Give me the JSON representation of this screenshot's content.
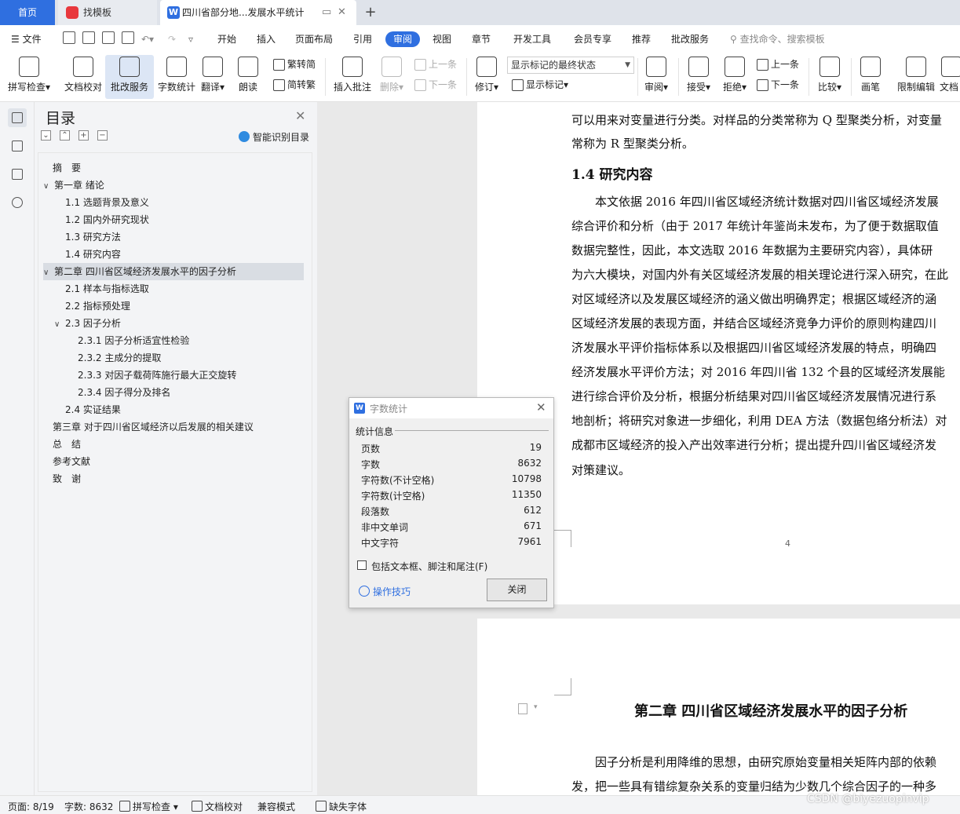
{
  "tabs": {
    "home": "首页",
    "template": "找模板",
    "document": "四川省部分地...发展水平统计"
  },
  "menu": {
    "file": "文件",
    "items": [
      "开始",
      "插入",
      "页面布局",
      "引用",
      "审阅",
      "视图",
      "章节",
      "开发工具",
      "会员专享",
      "推荐",
      "批改服务"
    ],
    "active": "审阅",
    "search": "查找命令、搜索模板"
  },
  "ribbon": {
    "spellcheck": "拼写检查",
    "doc_proof": "文档校对",
    "correction_service": "批改服务",
    "word_count": "字数统计",
    "translate": "翻译",
    "read_aloud": "朗读",
    "trad_to_simp": "繁转简",
    "simp_to_trad": "简转繁",
    "insert_comment": "插入批注",
    "delete": "删除",
    "prev_item": "上一条",
    "next_item": "下一条",
    "revise": "修订",
    "markup_state": "显示标记的最终状态",
    "show_markup": "显示标记",
    "review": "审阅",
    "accept": "接受",
    "reject": "拒绝",
    "prev_change": "上一条",
    "next_change": "下一条",
    "compare": "比较",
    "pen": "画笔",
    "restrict_edit": "限制编辑",
    "more": "文档"
  },
  "toc": {
    "title": "目录",
    "smart": "智能识别目录",
    "items": [
      {
        "text": "摘　要",
        "level": 0,
        "caret": ""
      },
      {
        "text": "第一章 绪论",
        "level": 0,
        "caret": "∨"
      },
      {
        "text": "1.1 选题背景及意义",
        "level": 1,
        "caret": ""
      },
      {
        "text": "1.2 国内外研究现状",
        "level": 1,
        "caret": ""
      },
      {
        "text": "1.3 研究方法",
        "level": 1,
        "caret": ""
      },
      {
        "text": "1.4 研究内容",
        "level": 1,
        "caret": ""
      },
      {
        "text": "第二章 四川省区域经济发展水平的因子分析",
        "level": 0,
        "caret": "∨"
      },
      {
        "text": "2.1 样本与指标选取",
        "level": 1,
        "caret": ""
      },
      {
        "text": "2.2 指标预处理",
        "level": 1,
        "caret": ""
      },
      {
        "text": "2.3 因子分析",
        "level": 1,
        "caret": "∨"
      },
      {
        "text": "2.3.1 因子分析适宜性检验",
        "level": 2,
        "caret": ""
      },
      {
        "text": "2.3.2 主成分的提取",
        "level": 2,
        "caret": ""
      },
      {
        "text": "2.3.3 对因子载荷阵施行最大正交旋转",
        "level": 2,
        "caret": ""
      },
      {
        "text": "2.3.4 因子得分及排名",
        "level": 2,
        "caret": ""
      },
      {
        "text": "2.4 实证结果",
        "level": 1,
        "caret": ""
      },
      {
        "text": "第三章 对于四川省区域经济以后发展的相关建议",
        "level": 0,
        "caret": ""
      },
      {
        "text": "总　结",
        "level": 0,
        "caret": ""
      },
      {
        "text": "参考文献",
        "level": 0,
        "caret": ""
      },
      {
        "text": "致　谢",
        "level": 0,
        "caret": ""
      }
    ]
  },
  "document": {
    "page1_lines": [
      "可以用来对变量进行分类。对样品的分类常称为 Q 型聚类分析，对变量",
      "常称为 R 型聚类分析。",
      "1.4  研究内容",
      "　　本文依据 2016 年四川省区域经济统计数据对四川省区域经济发展",
      "综合评价和分析（由于 2017 年统计年鉴尚未发布，为了便于数据取值",
      "数据完整性，因此，本文选取 2016 年数据为主要研究内容），具体研",
      "为六大模块，对国内外有关区域经济发展的相关理论进行深入研究，在此",
      "对区域经济以及发展区域经济的涵义做出明确界定；根据区域经济的涵",
      "区域经济发展的表现方面，并结合区域经济竞争力评价的原则构建四川",
      "济发展水平评价指标体系以及根据四川省区域经济发展的特点，明确四",
      "经济发展水平评价方法；对 2016 年四川省 132 个县的区域经济发展能",
      "进行综合评价及分析，根据分析结果对四川省区域经济发展情况进行系",
      "地剖析；将研究对象进一步细化，利用 DEA 方法（数据包络分析法）对",
      "成都市区域经济的投入产出效率进行分析；提出提升四川省区域经济发",
      "对策建议。"
    ],
    "page_number": "4",
    "chapter_title": "第二章  四川省区域经济发展水平的因子分析",
    "page2_lines": [
      "　　因子分析是利用降维的思想，由研究原始变量相关矩阵内部的依赖",
      "发，把一些具有错综复杂关系的变量归结为少数几个综合因子的一种多"
    ]
  },
  "dialog": {
    "title": "字数统计",
    "section": "统计信息",
    "stats": [
      {
        "label": "页数",
        "value": "19"
      },
      {
        "label": "字数",
        "value": "8632"
      },
      {
        "label": "字符数(不计空格)",
        "value": "10798"
      },
      {
        "label": "字符数(计空格)",
        "value": "11350"
      },
      {
        "label": "段落数",
        "value": "612"
      },
      {
        "label": "非中文单词",
        "value": "671"
      },
      {
        "label": "中文字符",
        "value": "7961"
      }
    ],
    "include_label": "包括文本框、脚注和尾注(F)",
    "tips": "操作技巧",
    "close": "关闭"
  },
  "status": {
    "page": "页面: 8/19",
    "words": "字数: 8632",
    "spellcheck": "拼写检查",
    "doc_proof": "文档校对",
    "compat": "兼容模式",
    "missing_font": "缺失字体"
  },
  "watermark": "CSDN @biyezuopinvip",
  "colors": {
    "accent": "#2f6fe0",
    "tab_bg": "#dfe3ea",
    "panel_bg": "#f3f4f6",
    "doc_bg": "#e9e9e9"
  }
}
